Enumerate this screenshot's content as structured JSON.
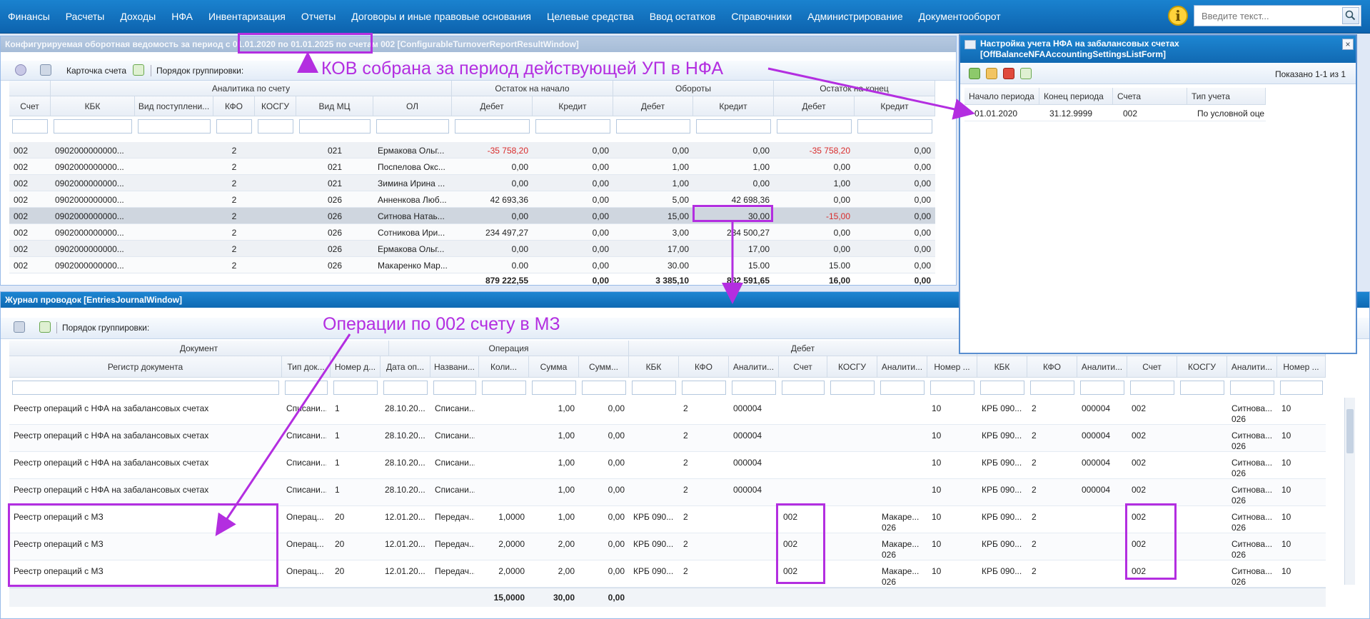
{
  "nav": {
    "items": [
      "Финансы",
      "Расчеты",
      "Доходы",
      "НФА",
      "Инвентаризация",
      "Отчеты",
      "Договоры и иные правовые основания",
      "Целевые средства",
      "Ввод остатков",
      "Справочники",
      "Администрирование",
      "Документооборот"
    ],
    "search_placeholder": "Введите текст...",
    "info_glyph": "i"
  },
  "kov": {
    "title": "Конфигурируемая оборотная ведомость за период с 01.01.2020 по 01.01.2025 по счетам 002 [ConfigurableTurnoverReportResultWindow]",
    "toolbar": {
      "account_card": "Карточка счета",
      "grouping": "Порядок группировки:"
    },
    "groups": {
      "analytics": "Аналитика по счету",
      "opening": "Остаток на начало",
      "turnover": "Обороты",
      "closing": "Остаток на конец"
    },
    "columns": [
      "Счет",
      "КБК",
      "Вид поступлени...",
      "КФО",
      "КОСГУ",
      "Вид МЦ",
      "ОЛ",
      "Дебет",
      "Кредит",
      "Дебет",
      "Кредит",
      "Дебет",
      "Кредит"
    ],
    "rows": [
      [
        "002",
        "0902000000000...",
        "",
        "2",
        "",
        "021",
        "Ермакова Ольг...",
        "-35 758,20",
        "0,00",
        "0,00",
        "0,00",
        "-35 758,20",
        "0,00"
      ],
      [
        "002",
        "0902000000000...",
        "",
        "2",
        "",
        "021",
        "Поспелова Окс...",
        "0,00",
        "0,00",
        "1,00",
        "1,00",
        "0,00",
        "0,00"
      ],
      [
        "002",
        "0902000000000...",
        "",
        "2",
        "",
        "021",
        "Зимина Ирина ...",
        "0,00",
        "0,00",
        "1,00",
        "0,00",
        "1,00",
        "0,00"
      ],
      [
        "002",
        "0902000000000...",
        "",
        "2",
        "",
        "026",
        "Анненкова Люб...",
        "42 693,36",
        "0,00",
        "5,00",
        "42 698,36",
        "0,00",
        "0,00"
      ],
      [
        "002",
        "0902000000000...",
        "",
        "2",
        "",
        "026",
        "Ситнова Натаь...",
        "0,00",
        "0,00",
        "15,00",
        "30,00",
        "-15,00",
        "0,00"
      ],
      [
        "002",
        "0902000000000...",
        "",
        "2",
        "",
        "026",
        "Сотникова Ири...",
        "234 497,27",
        "0,00",
        "3,00",
        "234 500,27",
        "0,00",
        "0,00"
      ],
      [
        "002",
        "0902000000000...",
        "",
        "2",
        "",
        "026",
        "Ермакова Ольг...",
        "0,00",
        "0,00",
        "17,00",
        "17,00",
        "0,00",
        "0,00"
      ],
      [
        "002",
        "0902000000000...",
        "",
        "2",
        "",
        "026",
        "Макаренко Мар...",
        "0.00",
        "0,00",
        "30.00",
        "15.00",
        "15.00",
        "0,00"
      ]
    ],
    "totals": [
      "879 222,55",
      "0,00",
      "3 385,10",
      "882 591,65",
      "16,00",
      "0,00"
    ]
  },
  "settings": {
    "title_line1": "Настройка учета НФА на забалансовых счетах",
    "title_line2": "[OffBalanceNFAAccountingSettingsListForm]",
    "shown": "Показано 1-1 из 1",
    "columns": [
      "Начало периода",
      "Конец периода",
      "Счета",
      "Тип учета"
    ],
    "rows": [
      [
        "01.01.2020",
        "31.12.9999",
        "002",
        "По условной оцен..."
      ]
    ],
    "close": "×"
  },
  "journal": {
    "title": "Журнал проводок [EntriesJournalWindow]",
    "toolbar": {
      "grouping": "Порядок группировки:"
    },
    "groups": {
      "document": "Документ",
      "operation": "Операция",
      "debit": "Дебет"
    },
    "columns": [
      "Регистр документа",
      "Тип док...",
      "Номер д...",
      "Дата оп...",
      "Названи...",
      "Коли...",
      "Сумма",
      "Сумм...",
      "КБК",
      "КФО",
      "Аналити...",
      "Счет",
      "КОСГУ",
      "Аналити...",
      "Номер ...",
      "КБК",
      "КФО",
      "Аналити...",
      "Счет",
      "КОСГУ",
      "Аналити...",
      "Номер ..."
    ],
    "rows": [
      {
        "c": [
          "Реестр операций с НФА на забалансовых счетах",
          "Списани...",
          "1",
          "28.10.20...",
          "Списани...",
          "",
          "1,00",
          "0,00",
          "",
          "2",
          "000004",
          "",
          "",
          "",
          "10",
          "КРБ 090...",
          "2",
          "000004",
          "002",
          "",
          "Ситнова...",
          "10"
        ],
        "sub": [
          "",
          "026"
        ]
      },
      {
        "c": [
          "Реестр операций с НФА на забалансовых счетах",
          "Списани...",
          "1",
          "28.10.20...",
          "Списани...",
          "",
          "1,00",
          "0,00",
          "",
          "2",
          "000004",
          "",
          "",
          "",
          "10",
          "КРБ 090...",
          "2",
          "000004",
          "002",
          "",
          "Ситнова...",
          "10"
        ],
        "sub": [
          "",
          "026"
        ]
      },
      {
        "c": [
          "Реестр операций с НФА на забалансовых счетах",
          "Списани...",
          "1",
          "28.10.20...",
          "Списани...",
          "",
          "1,00",
          "0,00",
          "",
          "2",
          "000004",
          "",
          "",
          "",
          "10",
          "КРБ 090...",
          "2",
          "000004",
          "002",
          "",
          "Ситнова...",
          "10"
        ],
        "sub": [
          "",
          "026"
        ]
      },
      {
        "c": [
          "Реестр операций с НФА на забалансовых счетах",
          "Списани...",
          "1",
          "28.10.20...",
          "Списани...",
          "",
          "1,00",
          "0,00",
          "",
          "2",
          "000004",
          "",
          "",
          "",
          "10",
          "КРБ 090...",
          "2",
          "000004",
          "002",
          "",
          "Ситнова...",
          "10"
        ],
        "sub": [
          "",
          "026"
        ]
      },
      {
        "c": [
          "Реестр операций с МЗ",
          "Операц...",
          "20",
          "12.01.20...",
          "Передач...",
          "1,0000",
          "1,00",
          "0,00",
          "КРБ 090...",
          "2",
          "",
          "002",
          "",
          "Макаре...",
          "10",
          "КРБ 090...",
          "2",
          "",
          "002",
          "",
          "Ситнова...",
          "10"
        ],
        "sub": [
          "026",
          "026"
        ]
      },
      {
        "c": [
          "Реестр операций с МЗ",
          "Операц...",
          "20",
          "12.01.20...",
          "Передач...",
          "2,0000",
          "2,00",
          "0,00",
          "КРБ 090...",
          "2",
          "",
          "002",
          "",
          "Макаре...",
          "10",
          "КРБ 090...",
          "2",
          "",
          "002",
          "",
          "Ситнова...",
          "10"
        ],
        "sub": [
          "026",
          "026"
        ]
      },
      {
        "c": [
          "Реестр операций с МЗ",
          "Операц...",
          "20",
          "12.01.20...",
          "Передач...",
          "2,0000",
          "2,00",
          "0,00",
          "КРБ 090...",
          "2",
          "",
          "002",
          "",
          "Макаре...",
          "10",
          "КРБ 090...",
          "2",
          "",
          "002",
          "",
          "Ситнова...",
          "10"
        ],
        "sub": [
          "026",
          "026"
        ]
      }
    ],
    "totals": [
      "15,0000",
      "30,00",
      "0,00"
    ]
  },
  "annotations": {
    "kov_note": "КОВ собрана за период действующей УП в НФА",
    "ops_note": "Операции по 002 счету в МЗ"
  },
  "colors": {
    "nav": "#1a82cf",
    "annotation": "#b32ee0",
    "negative": "#d92b2b"
  }
}
